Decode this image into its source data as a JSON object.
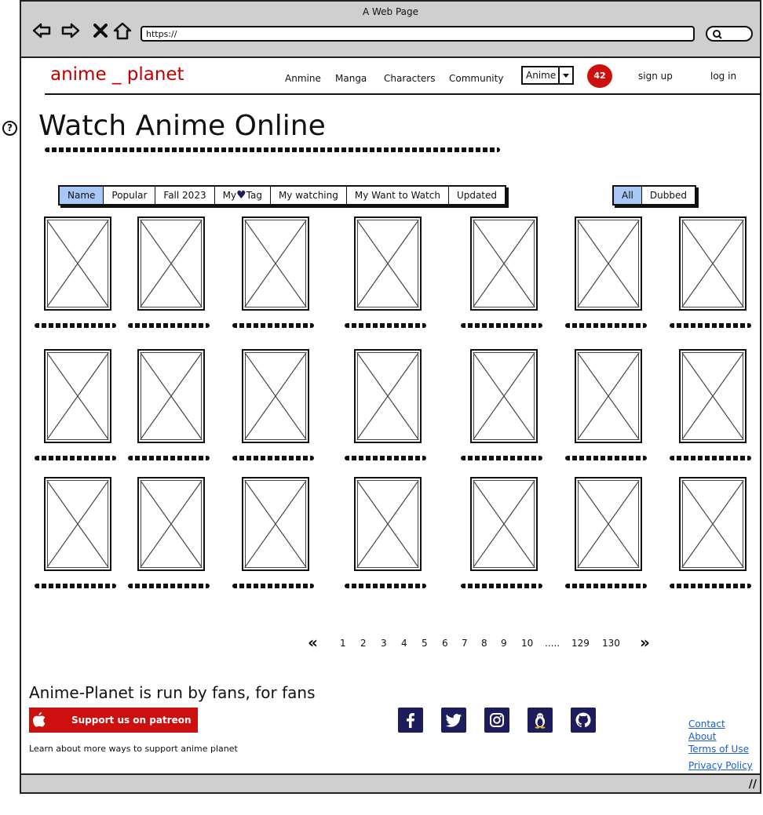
{
  "window": {
    "title": "A Web Page",
    "url": "https://"
  },
  "header": {
    "logo": "anime _ planet",
    "nav": [
      "Anmine",
      "Manga",
      "Characters",
      "Community"
    ],
    "type_select": "Anime",
    "badge": "42",
    "sign_up": "sign up",
    "log_in": "log in"
  },
  "main": {
    "title": "Watch Anime Online",
    "tabs": [
      "Name",
      "Popular",
      "Fall 2023",
      "My",
      "Tag",
      "My watching",
      "My Want to Watch",
      "Updated"
    ],
    "filter": [
      "All",
      "Dubbed"
    ],
    "grid": {
      "rows": 3,
      "columns": 7
    }
  },
  "pagination": {
    "prev": "«",
    "pages": [
      "1",
      "2",
      "3",
      "4",
      "5",
      "6",
      "7",
      "8",
      "9",
      "10",
      ".....",
      "129",
      "130"
    ],
    "next": "»"
  },
  "footer": {
    "tagline": "Anime-Planet is run by fans, for fans",
    "patreon": "Support us on patreon",
    "more_ways": "Learn about more ways to support anime planet",
    "social": [
      "facebook-icon",
      "twitter-icon",
      "instagram-icon",
      "linux-icon",
      "github-icon"
    ],
    "links": [
      "Contact",
      "About",
      "Terms of Use",
      "Privacy Policy"
    ]
  },
  "colors": {
    "brand_red": "#cc1010",
    "active_tab": "#a8c8f8",
    "social_navy": "#1d1d5c",
    "link_blue": "#1a5fd0"
  }
}
